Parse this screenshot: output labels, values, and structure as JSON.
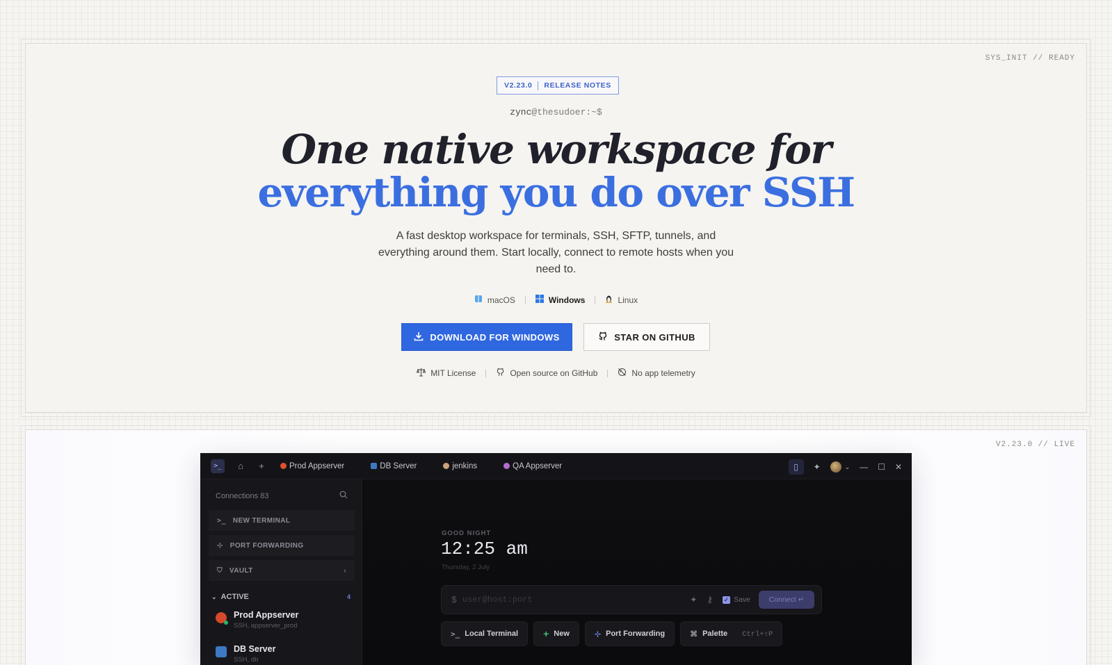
{
  "hero": {
    "corner_tag": "SYS_INIT // READY",
    "release": {
      "version": "V2.23.0",
      "notes_label": "RELEASE NOTES"
    },
    "prompt_user": "zync",
    "prompt_rest": "@thesudoer:~$",
    "headline_line1": "One native workspace for",
    "headline_line2": "everything you do over SSH",
    "subtitle": "A fast desktop workspace for terminals, SSH, SFTP, tunnels, and everything around them. Start locally, connect to remote hosts when you need to.",
    "platforms": [
      {
        "label": "macOS",
        "icon": "apple-icon",
        "active": false
      },
      {
        "label": "Windows",
        "icon": "windows-icon",
        "active": true
      },
      {
        "label": "Linux",
        "icon": "linux-icon",
        "active": false
      }
    ],
    "download_label": "DOWNLOAD FOR WINDOWS",
    "github_label": "STAR ON GITHUB",
    "meta": [
      {
        "label": "MIT License",
        "icon": "scale-icon"
      },
      {
        "label": "Open source on GitHub",
        "icon": "github-icon"
      },
      {
        "label": "No app telemetry",
        "icon": "no-tracking-icon"
      }
    ],
    "colors": {
      "accent": "#2f67e0",
      "headline_blue": "#3b6fe0"
    }
  },
  "preview": {
    "corner_tag": "V2.23.0 // LIVE",
    "app": {
      "tabs": [
        "Prod Appserver",
        "DB Server",
        "jenkins",
        "QA Appserver"
      ],
      "sidebar": {
        "search_label": "Connections 83",
        "buttons": [
          "NEW TERMINAL",
          "PORT FORWARDING",
          "VAULT"
        ],
        "active_label": "ACTIVE",
        "active_count": "4",
        "connections": [
          {
            "name": "Prod Appserver",
            "sub": "SSH, appserver_prod"
          },
          {
            "name": "DB Server",
            "sub": "SSH, db"
          }
        ]
      },
      "main": {
        "greeting": "GOOD NIGHT",
        "clock": "12:25 am",
        "date": "Thursday, 2 July",
        "input_prompt": "$",
        "input_placeholder": "user@host:port",
        "save_label": "Save",
        "connect_label": "Connect ↵",
        "quick_actions": [
          "Local Terminal",
          "New",
          "Port Forwarding",
          "Palette"
        ],
        "palette_shortcut": "Ctrl+⇧P"
      }
    }
  }
}
